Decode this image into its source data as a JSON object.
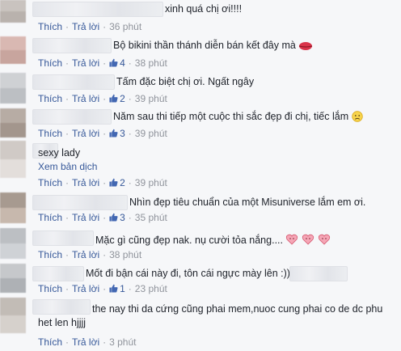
{
  "labels": {
    "like": "Thích",
    "reply": "Trả lời",
    "see_translation": "Xem bản dịch",
    "separator": "·"
  },
  "comments": [
    {
      "text": "xinh quá chị ơi!!!!",
      "likes": null,
      "time": "36 phút"
    },
    {
      "text": "Bộ bikini thần thánh diễn bán kết đây mà",
      "likes": "4",
      "time": "38 phút",
      "emoji": "kiss-lips"
    },
    {
      "text": "Tấm đặc biệt chị ơi. Ngất ngây",
      "likes": "2",
      "time": "39 phút"
    },
    {
      "text": "Năm sau thi tiếp một cuộc thi sắc đẹp đi chị, tiếc lắm",
      "likes": "3",
      "time": "39 phút",
      "emoji": "disappointed-face"
    },
    {
      "text": "sexy lady",
      "likes": "2",
      "time": "39 phút",
      "translate": true
    },
    {
      "text": "Nhìn đẹp tiêu chuẩn của một Misuniverse lắm em ơi.",
      "likes": "3",
      "time": "35 phút"
    },
    {
      "text": "Mặc gì cũng đẹp nak. nụ cười tỏa nắng....",
      "likes": null,
      "time": "38 phút",
      "emoji": "heart-faces"
    },
    {
      "text": "Mốt đi bận cái này đi, tôn cái ngực mày lên :)))",
      "likes": "1",
      "time": "23 phút"
    },
    {
      "text": "the nay thi da cứng cũng phai mem,nuoc cung phai co de dc phu het len hjjjj",
      "likes": null,
      "time": "3 phút"
    }
  ],
  "colors": {
    "link": "#365899",
    "meta": "#90949c",
    "text": "#1d2129",
    "like_blue": "#4267b2"
  }
}
